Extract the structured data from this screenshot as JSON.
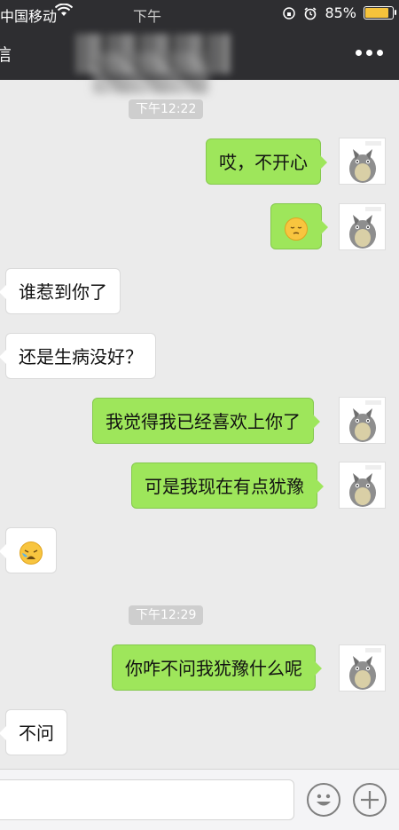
{
  "status_bar": {
    "carrier": "中国移动",
    "time": "下午",
    "battery": "85%",
    "battery_level": 0.85,
    "battery_color": "#f6c33b"
  },
  "nav": {
    "back_text": "信"
  },
  "colors": {
    "sent_bubble": "#9ee65b",
    "received_bubble": "#ffffff",
    "title_bar": "#2e2e31"
  },
  "timestamps": [
    "下午12:22",
    "下午12:29"
  ],
  "messages": [
    {
      "side": "sent",
      "text": "哎，不开心"
    },
    {
      "side": "sent",
      "emoji": "pensive-face"
    },
    {
      "side": "received",
      "text": "谁惹到你了"
    },
    {
      "side": "received",
      "text": "还是生病没好？"
    },
    {
      "side": "sent",
      "text": "我觉得我已经喜欢上你了"
    },
    {
      "side": "sent",
      "text": "可是我现在有点犹豫"
    },
    {
      "side": "received",
      "emoji": "crying-face"
    },
    {
      "side": "sent",
      "text": "你咋不问我犹豫什么呢"
    },
    {
      "side": "received",
      "text": "不问"
    }
  ],
  "input_bar": {
    "icons": [
      "emoji-icon",
      "plus-icon"
    ]
  }
}
